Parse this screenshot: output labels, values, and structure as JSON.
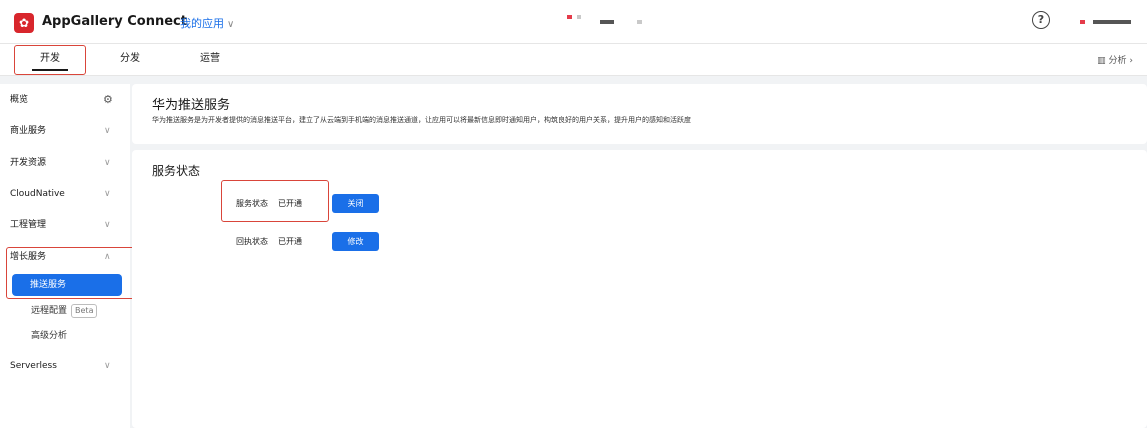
{
  "header": {
    "logo_text": "✿",
    "app_title": "AppGallery Connect",
    "app_switch_label": "我的应用",
    "help_label": "?"
  },
  "tabs": [
    {
      "label": "开发"
    },
    {
      "label": "分发"
    },
    {
      "label": "运营"
    }
  ],
  "analysis_label": "分析",
  "sidebar": {
    "overview": "概览",
    "items": [
      {
        "label": "商业服务"
      },
      {
        "label": "开发资源"
      },
      {
        "label": "CloudNative"
      },
      {
        "label": "工程管理"
      },
      {
        "label": "增长服务"
      }
    ],
    "active_item": "推送服务",
    "sub_items": [
      {
        "label": "远程配置",
        "badge": "Beta"
      },
      {
        "label": "高级分析"
      }
    ],
    "serverless": "Serverless"
  },
  "service_panel": {
    "title": "华为推送服务",
    "description": "华为推送服务是为开发者提供的消息推送平台，建立了从云端到手机端的消息推送通道，让应用可以将最新信息即时通知用户，构筑良好的用户关系，提升用户的感知和活跃度"
  },
  "status_panel": {
    "title": "服务状态",
    "rows": [
      {
        "label": "服务状态",
        "value": "已开通",
        "button": "关闭"
      },
      {
        "label": "回执状态",
        "value": "已开通",
        "button": "修改"
      }
    ]
  },
  "colors": {
    "accent": "#1a6fe8",
    "highlight_border": "#d9453a",
    "brand_red": "#d8262c"
  }
}
